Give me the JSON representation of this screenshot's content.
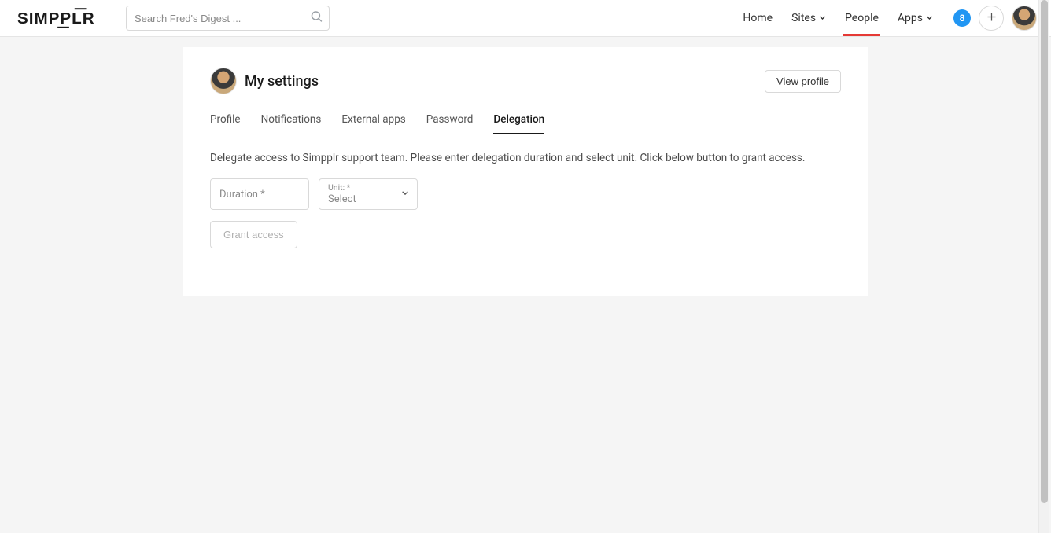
{
  "header": {
    "logo_text": "SIMPPLR",
    "search_placeholder": "Search Fred's Digest ...",
    "nav": {
      "home": "Home",
      "sites": "Sites",
      "people": "People",
      "apps": "Apps"
    },
    "notification_count": "8"
  },
  "settings": {
    "title": "My settings",
    "view_profile_btn": "View profile",
    "tabs": {
      "profile": "Profile",
      "notifications": "Notifications",
      "external_apps": "External apps",
      "password": "Password",
      "delegation": "Delegation"
    },
    "delegation": {
      "description": "Delegate access to Simpplr support team. Please enter delegation duration and select unit. Click below button to grant access.",
      "duration_label": "Duration *",
      "unit_label": "Unit: *",
      "unit_value": "Select",
      "grant_btn": "Grant access"
    }
  }
}
